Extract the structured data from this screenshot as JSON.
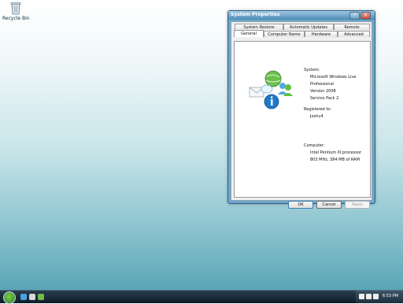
{
  "desktop": {
    "recycle_bin_label": "Recycle Bin"
  },
  "window": {
    "title": "System Properties",
    "help_glyph": "?",
    "close_glyph": "X",
    "tabs_top": [
      "System Restore",
      "Automatic Updates",
      "Remote"
    ],
    "tabs_bottom": [
      "General",
      "Computer Name",
      "Hardware",
      "Advanced"
    ],
    "active_tab": "General"
  },
  "general": {
    "system_heading": "System:",
    "system_lines": [
      "Microsoft Windows Live",
      "Professional",
      "Version 2008",
      "Service Pack 2"
    ],
    "registered_heading": "Registered to:",
    "registered_lines": [
      "Joshu4"
    ],
    "computer_heading": "Computer:",
    "computer_lines": [
      "Intel Pentium III processor",
      "803 MHz, 384 MB of RAM"
    ]
  },
  "buttons": {
    "ok": "OK",
    "cancel": "Cancel",
    "apply": "Apply"
  },
  "taskbar": {
    "clock": "6:53 PM"
  },
  "colors": {
    "window_frame": "#6fa6c7",
    "taskbar": "#0e1c28",
    "ok_focus": "#3c7fb1"
  }
}
